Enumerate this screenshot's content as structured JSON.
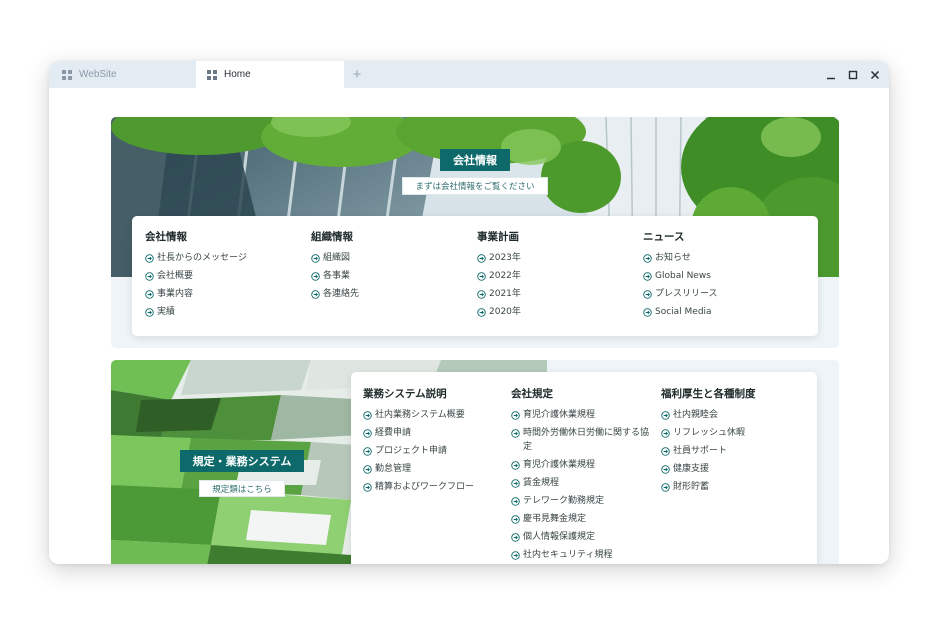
{
  "tabs": [
    {
      "label": "WebSite",
      "active": false
    },
    {
      "label": "Home",
      "active": true
    }
  ],
  "new_tab": "+",
  "colors": {
    "accent": "#0e6a6a",
    "tabbar": "#e4ecf3",
    "section_bg": "#eef4f7"
  },
  "icons": {
    "tab": "grid-icon",
    "link": "circle-arrow-right-icon",
    "minimize": "minimize-icon",
    "maximize": "maximize-icon",
    "close": "close-icon"
  },
  "company": {
    "badge": "会社情報",
    "sub": "まずは会社情報をご覧ください",
    "columns": [
      {
        "title": "会社情報",
        "links": [
          "社長からのメッセージ",
          "会社概要",
          "事業内容",
          "実績"
        ]
      },
      {
        "title": "組織情報",
        "links": [
          "組織図",
          "各事業",
          "各連絡先"
        ]
      },
      {
        "title": "事業計画",
        "links": [
          "2023年",
          "2022年",
          "2021年",
          "2020年"
        ]
      },
      {
        "title": "ニュース",
        "links": [
          "お知らせ",
          "Global News",
          "プレスリリース",
          "Social Media"
        ]
      }
    ]
  },
  "rules": {
    "badge": "規定・業務システム",
    "sub": "規定類はこちら",
    "columns": [
      {
        "title": "業務システム説明",
        "links": [
          "社内業務システム概要",
          "経費申請",
          "プロジェクト申請",
          "勤怠管理",
          "精算およびワークフロー"
        ]
      },
      {
        "title": "会社規定",
        "links": [
          "育児介護休業規程",
          "時間外労働休日労働に関する協定",
          "育児介護休業規程",
          "賃金規程",
          "テレワーク勤務規定",
          "慶弔見舞金規定",
          "個人情報保護規定",
          "社内セキュリティ規程"
        ]
      },
      {
        "title": "福利厚生と各種制度",
        "links": [
          "社内親睦会",
          "リフレッシュ休暇",
          "社員サポート",
          "健康支援",
          "財形貯蓄"
        ]
      }
    ]
  }
}
